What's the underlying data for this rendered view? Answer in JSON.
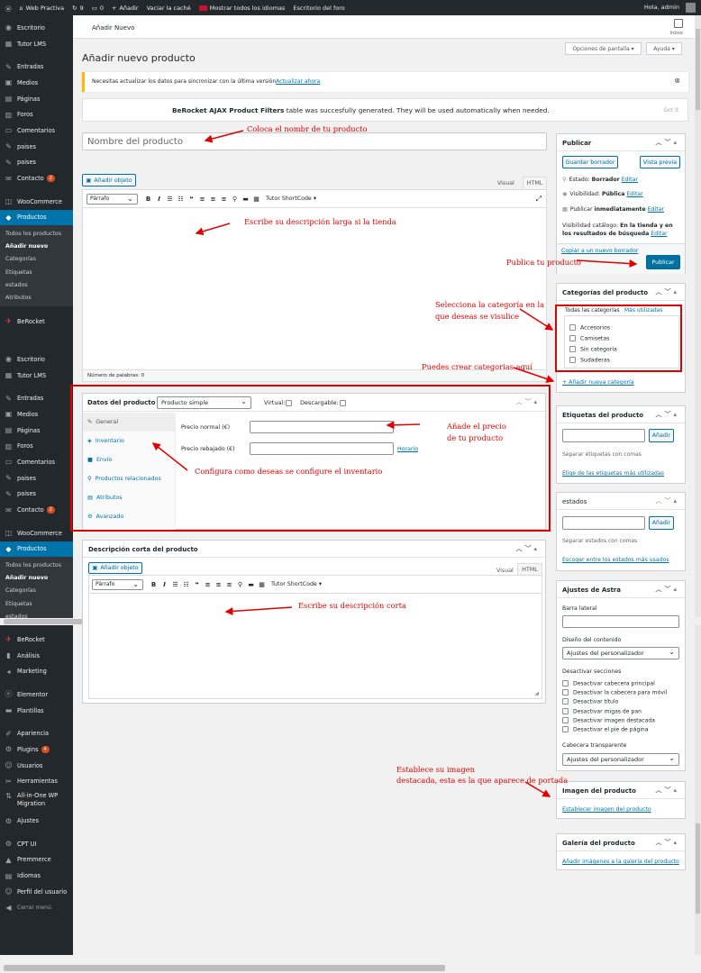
{
  "adminbar": {
    "site": "Web Practiva",
    "updates": "9",
    "comments": "0",
    "new": "Añadir",
    "cache": "Vaciar la caché",
    "languages": "Mostrar todos los idiomas",
    "forum": "Escritorio del foro",
    "greeting": "Hola, admin"
  },
  "sidebar_top": {
    "items": [
      "Escritorio",
      "Tutor LMS",
      "Entradas",
      "Medios",
      "Páginas",
      "Foros",
      "Comentarios",
      "paises",
      "paises",
      "Contacto",
      "WooCommerce",
      "Productos"
    ],
    "contact_badge": "2",
    "subitems": [
      "Todos los productos",
      "Añadir nuevo",
      "Categorías",
      "Etiquetas",
      "estados",
      "Atributos"
    ],
    "berocket": "BeRocket"
  },
  "sidebar_mid": {
    "items": [
      "Escritorio",
      "Tutor LMS",
      "Entradas",
      "Medios",
      "Páginas",
      "Foros",
      "Comentarios",
      "paises",
      "paises",
      "Contacto",
      "WooCommerce",
      "Productos"
    ],
    "contact_badge": "2",
    "subitems": [
      "Todos los productos",
      "Añadir nuevo",
      "Categorías",
      "Etiquetas",
      "estados"
    ]
  },
  "sidebar_bottom": {
    "items": [
      "BeRocket",
      "Análisis",
      "Marketing",
      "Elementor",
      "Plantillas",
      "Apariencia",
      "Plugins",
      "Usuarios",
      "Herramientas",
      "All-in-One WP Migration",
      "Ajustes",
      "CPT UI",
      "Premmerce",
      "Idiomas",
      "Perfil del usuario",
      "Cerrar menú"
    ],
    "plugins_badge": "4"
  },
  "topbar": {
    "title": "Añadir Nuevo",
    "inbox": "Inbox"
  },
  "screen_options": "Opciones de pantalla",
  "help": "Ayuda",
  "page_title": "Añadir nuevo producto",
  "notice": {
    "text": "Necesitas actualizar los datos para sincronizar con la última versión",
    "link": "Actualizar ahora"
  },
  "berocket_notice": {
    "bold": "BeRocket AJAX Product Filters",
    "text": "table was succesfully generated. They will be used automatically when needed.",
    "gotit": "Got it"
  },
  "title_placeholder": "Nombre del producto",
  "editor": {
    "add_media": "Añadir objeto",
    "tab_visual": "Visual",
    "tab_html": "HTML",
    "paragraph": "Párrafo",
    "shortcode": "Tutor ShortCode",
    "wordcount": "Número de palabras: 0"
  },
  "product_data": {
    "title": "Datos del producto —",
    "type": "Producto simple",
    "virtual": "Virtual:",
    "downloadable": "Descargable:",
    "tabs": [
      "General",
      "Inventario",
      "Envío",
      "Productos relacionados",
      "Atributos",
      "Avanzado"
    ],
    "regular_price": "Precio normal (€)",
    "sale_price": "Precio rebajado (€)",
    "schedule": "Horario"
  },
  "short_desc": {
    "title": "Descripción corta del producto",
    "add_media": "Añadir objeto",
    "tab_visual": "Visual",
    "tab_html": "HTML",
    "paragraph": "Párrafo",
    "shortcode": "Tutor ShortCode"
  },
  "publish": {
    "title": "Publicar",
    "save_draft": "Guardar borrador",
    "preview": "Vista previa",
    "status_label": "Estado:",
    "status_value": "Borrador",
    "edit": "Editar",
    "visibility_label": "Visibilidad:",
    "visibility_value": "Pública",
    "publish_label": "Publicar",
    "publish_value": "inmediatamente",
    "catalog_label": "Visibilidad catálogo:",
    "catalog_value": "En la tienda y en los resultados de búsqueda",
    "copy_draft": "Copiar a un nuevo borrador",
    "publish_btn": "Publicar"
  },
  "categories": {
    "title": "Categorías del producto",
    "tab_all": "Todas las categorías",
    "tab_used": "Más utilizadas",
    "items": [
      "Accesorios",
      "Camisetas",
      "Sin categoría",
      "Sudaderas"
    ],
    "add_new": "+ Añadir nueva categoría"
  },
  "tags": {
    "title": "Etiquetas del producto",
    "add": "Añadir",
    "hint": "Separar etiquetas con comas",
    "choose": "Elige de las etiquetas más utilizadas"
  },
  "estados": {
    "title": "estados",
    "add": "Añadir",
    "hint": "Separar estados con comas",
    "choose": "Escoger entre los estados más usados"
  },
  "astra": {
    "title": "Ajustes de Astra",
    "sidebar_label": "Barra lateral",
    "content_label": "Diseño del contenido",
    "content_value": "Ajustes del personalizador",
    "disable_label": "Desactivar secciones",
    "disable_items": [
      "Desactivar cabecera principal",
      "Desactivar la cabecera para móvil",
      "Desactivar título",
      "Desactivar migas de pan",
      "Desactivar imagen destacada",
      "Desactivar el pie de página"
    ],
    "transparent_label": "Cabecera transparente",
    "transparent_value": "Ajustes del personalizador"
  },
  "image": {
    "title": "Imagen del producto",
    "link": "Establecer imagen del producto"
  },
  "gallery": {
    "title": "Galería del producto",
    "link": "Añadir imágenes a la galería del producto"
  },
  "annotations": {
    "title": "Coloca el nombr de tu producto",
    "desc": "Escribe su descripción larga si la tienda",
    "publish": "Publica tu producto",
    "category_1": "Selecciona la categoría en la",
    "category_2": "que deseas se visulice",
    "create_cat": "Puedes crear categorias aquí",
    "price_1": "Añade el precio",
    "price_2": "de tu producto",
    "inventory": "Configura como deseas se configure el inventario",
    "short": "Escribe su descripción corta",
    "image_1": "Establece su imagen",
    "image_2": "destacada, esta es la que aparece de portada"
  },
  "colors": {
    "accent": "#0073aa",
    "annotation": "#e10000",
    "sidebar": "#23282d"
  }
}
